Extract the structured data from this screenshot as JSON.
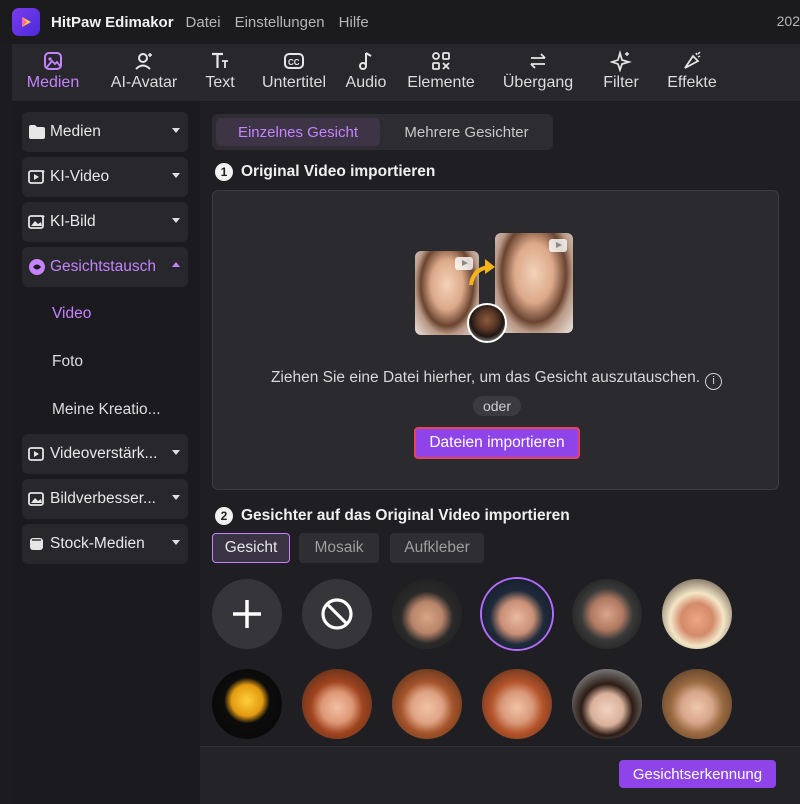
{
  "app": {
    "title": "HitPaw Edimakor",
    "year_partial": "202"
  },
  "menu": [
    "Datei",
    "Einstellungen",
    "Hilfe"
  ],
  "toolbar": [
    {
      "label": "Medien",
      "icon": "media-icon",
      "active": true
    },
    {
      "label": "AI-Avatar",
      "icon": "avatar-icon",
      "active": false
    },
    {
      "label": "Text",
      "icon": "text-icon",
      "active": false
    },
    {
      "label": "Untertitel",
      "icon": "subtitle-icon",
      "active": false
    },
    {
      "label": "Audio",
      "icon": "music-note-icon",
      "active": false
    },
    {
      "label": "Elemente",
      "icon": "elements-icon",
      "active": false
    },
    {
      "label": "Übergang",
      "icon": "transition-icon",
      "active": false
    },
    {
      "label": "Filter",
      "icon": "sparkle-icon",
      "active": false
    },
    {
      "label": "Effekte",
      "icon": "effects-icon",
      "active": false
    }
  ],
  "sidebar": {
    "items": [
      {
        "label": "Medien",
        "icon": "folder-icon"
      },
      {
        "label": "KI-Video",
        "icon": "ai-video-icon"
      },
      {
        "label": "KI-Bild",
        "icon": "ai-image-icon"
      },
      {
        "label": "Gesichtstausch",
        "icon": "face-swap-icon",
        "open": true
      },
      {
        "label": "Videoverstärk...",
        "icon": "video-enhance-icon"
      },
      {
        "label": "Bildverbesser...",
        "icon": "image-enhance-icon"
      },
      {
        "label": "Stock-Medien",
        "icon": "stock-icon"
      }
    ],
    "sub_items": [
      {
        "label": "Video",
        "active": true
      },
      {
        "label": "Foto",
        "active": false
      },
      {
        "label": "Meine Kreatio...",
        "active": false
      }
    ]
  },
  "main": {
    "tabs": [
      "Einzelnes Gesicht",
      "Mehrere Gesichter"
    ],
    "step1": {
      "num": "1",
      "title": "Original Video importieren"
    },
    "drop_text": "Ziehen Sie eine Datei hierher, um das Gesicht auszutauschen.",
    "info_glyph": "i",
    "or_text": "oder",
    "import_button": "Dateien importieren",
    "step2": {
      "num": "2",
      "title": "Gesichter auf das Original Video importieren"
    },
    "face_tabs": [
      "Gesicht",
      "Mosaik",
      "Aufkleber"
    ],
    "detect_button": "Gesichtserkennung"
  },
  "colors": {
    "accent": "#c583ff",
    "button": "#8e44e8",
    "highlight_border": "#e8455c"
  }
}
